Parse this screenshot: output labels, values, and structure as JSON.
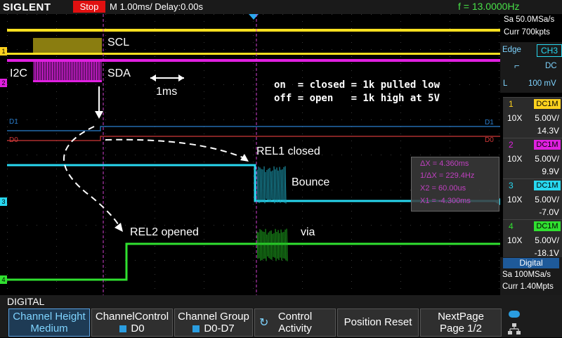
{
  "header": {
    "brand": "SIGLENT",
    "run_state": "Stop",
    "timebase": "M 1.00ms/ Delay:0.00s",
    "frequency": "f = 13.0000Hz"
  },
  "annotations": {
    "scl": "SCL",
    "sda": "SDA",
    "i2c": "I2C",
    "scale": "1ms",
    "note_line1": "on  = closed = 1k pulled low",
    "note_line2": "off = open   = 1k high at 5V",
    "rel1": "REL1 closed",
    "bounce": "Bounce",
    "rel2": "REL2 opened",
    "via": "via"
  },
  "cursor_box": {
    "dx": "ΔX = 4.360ms",
    "inv_dx": "1/ΔX = 229.4Hz",
    "x2": "X2 = 60.00us",
    "x1": "X1 = -4.300ms"
  },
  "trace_labels": {
    "d1": "D1",
    "d0": "D0",
    "ch1": "1",
    "ch2": "2",
    "ch3": "3",
    "ch4": "4"
  },
  "acquisition": {
    "sample_rate": "Sa 50.0MSa/s",
    "memory": "Curr 700kpts"
  },
  "trigger": {
    "mode": "Edge",
    "source": "CH3",
    "coupling": "DC",
    "slope_label": "L",
    "level": "100 mV"
  },
  "channels": [
    {
      "num": "1",
      "coupling": "DC1M",
      "probe": "10X",
      "scale": "5.00V/",
      "offset": "14.3V",
      "color": "#ffd21e"
    },
    {
      "num": "2",
      "coupling": "DC1M",
      "probe": "10X",
      "scale": "5.00V/",
      "offset": "9.9V",
      "color": "#e020e0"
    },
    {
      "num": "3",
      "coupling": "DC1M",
      "probe": "10X",
      "scale": "5.00V/",
      "offset": "-7.0V",
      "color": "#28d8f0"
    },
    {
      "num": "4",
      "coupling": "DC1M",
      "probe": "10X",
      "scale": "5.00V/",
      "offset": "-18.1V",
      "color": "#30e030"
    }
  ],
  "digital_info": {
    "title": "Digital",
    "sample_rate": "Sa 100MSa/s",
    "memory": "Curr 1.40Mpts"
  },
  "menu": {
    "title": "DIGITAL",
    "buttons": [
      {
        "line1": "Channel Height",
        "line2": "Medium"
      },
      {
        "line1": "ChannelControl",
        "line2": "D0"
      },
      {
        "line1": "Channel Group",
        "line2": "D0-D7"
      },
      {
        "line1": "Control",
        "line2": "Activity"
      },
      {
        "line1": "Position Reset",
        "line2": ""
      },
      {
        "line1": "NextPage",
        "line2": "Page 1/2"
      }
    ]
  }
}
